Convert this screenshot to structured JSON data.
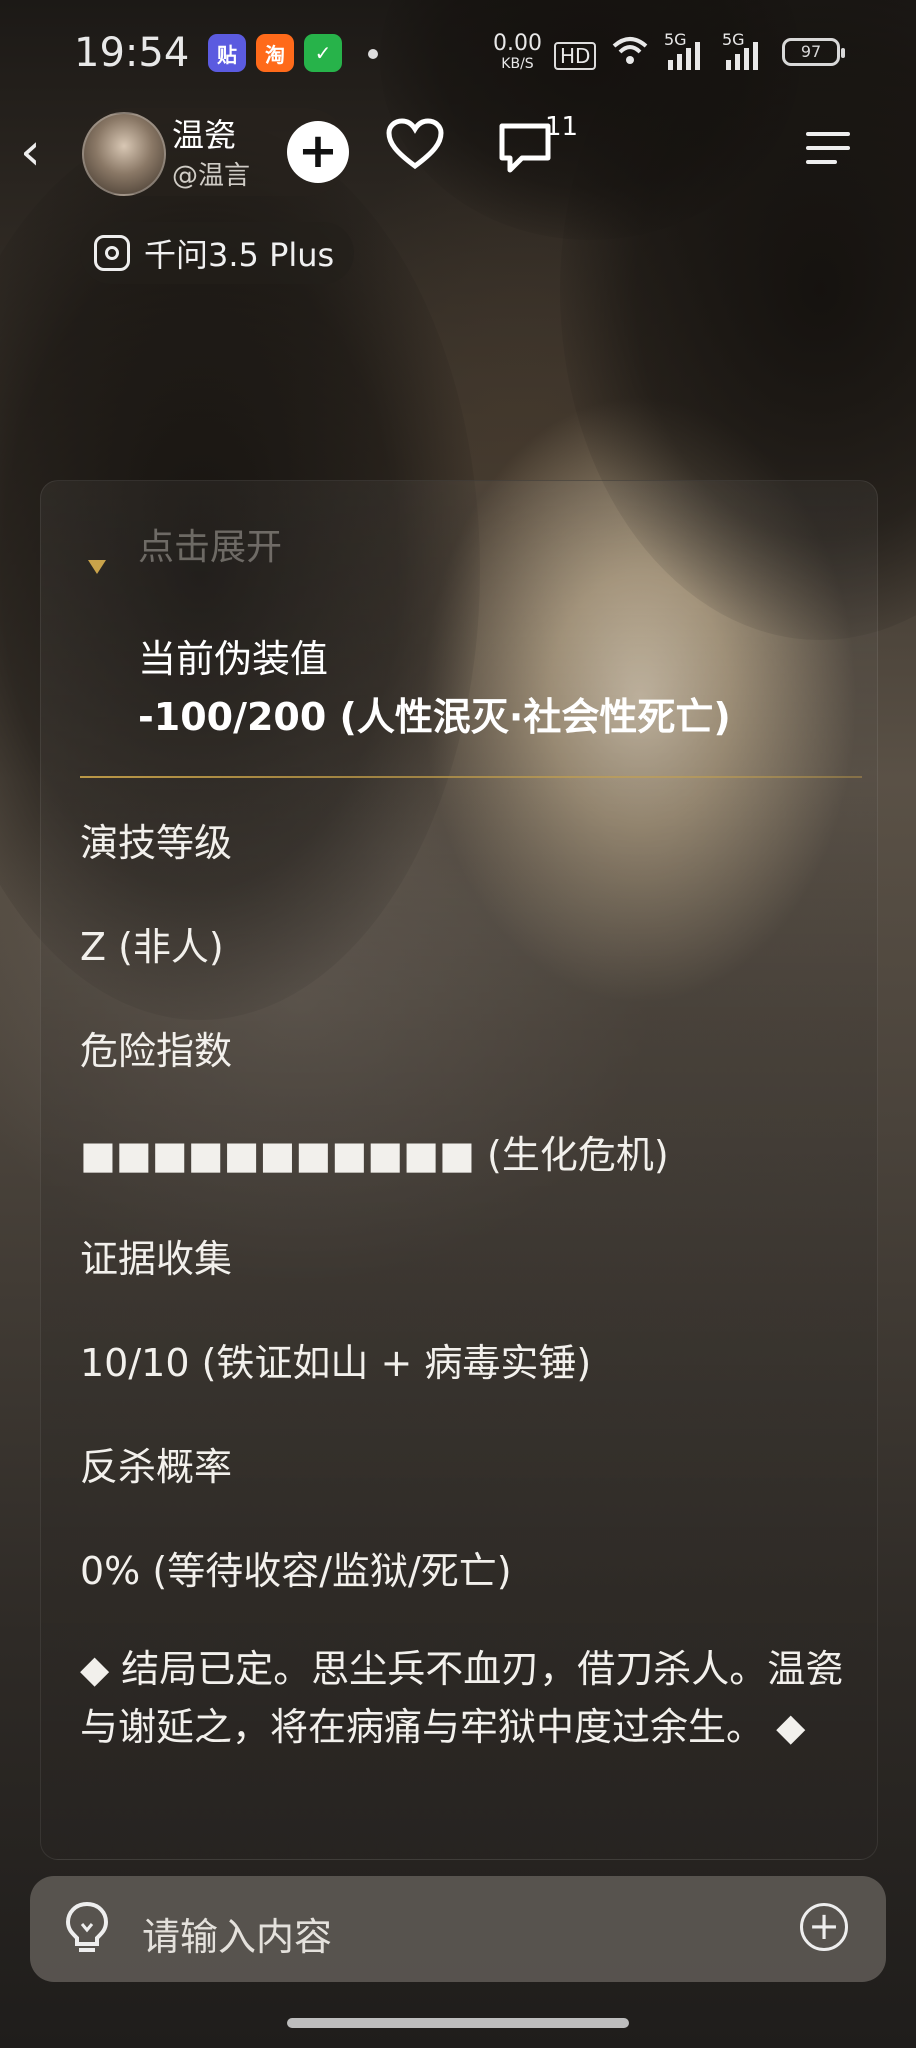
{
  "status_bar": {
    "time": "19:54",
    "net_speed": "0.00",
    "net_unit": "KB/S",
    "hd": "HD",
    "signal_1": "5G",
    "signal_2": "5G",
    "battery": "97",
    "app_icons": [
      {
        "name": "tie-app-icon",
        "glyph": "贴",
        "color": "#5b5be0"
      },
      {
        "name": "taobao-app-icon",
        "glyph": "淘",
        "color": "#ff6a1a"
      },
      {
        "name": "shield-app-icon",
        "glyph": "✓",
        "color": "#27b34a"
      }
    ]
  },
  "header": {
    "character_name": "温瓷",
    "character_handle": "@温言",
    "comment_count": "11"
  },
  "model": {
    "label": "千问3.5 Plus"
  },
  "card": {
    "expand_text": "点击展开",
    "disguise_label": "当前伪装值",
    "disguise_value": "-100/200 (人性泯灭·社会性死亡)",
    "rows": [
      "演技等级",
      "Z (非人)",
      "危险指数",
      "■■■■■■■■■■■ (生化危机)",
      "证据收集",
      "10/10 (铁证如山 + 病毒实锤)",
      "反杀概率",
      "0% (等待收容/监狱/死亡)"
    ],
    "closing": "◆ 结局已定。思尘兵不血刃，借刀杀人。温瓷与谢延之，将在病痛与牢狱中度过余生。 ◆"
  },
  "input": {
    "placeholder": "请输入内容"
  },
  "colors": {
    "accent_gold": "#c9a34a",
    "input_bar": "#5f5a55"
  }
}
